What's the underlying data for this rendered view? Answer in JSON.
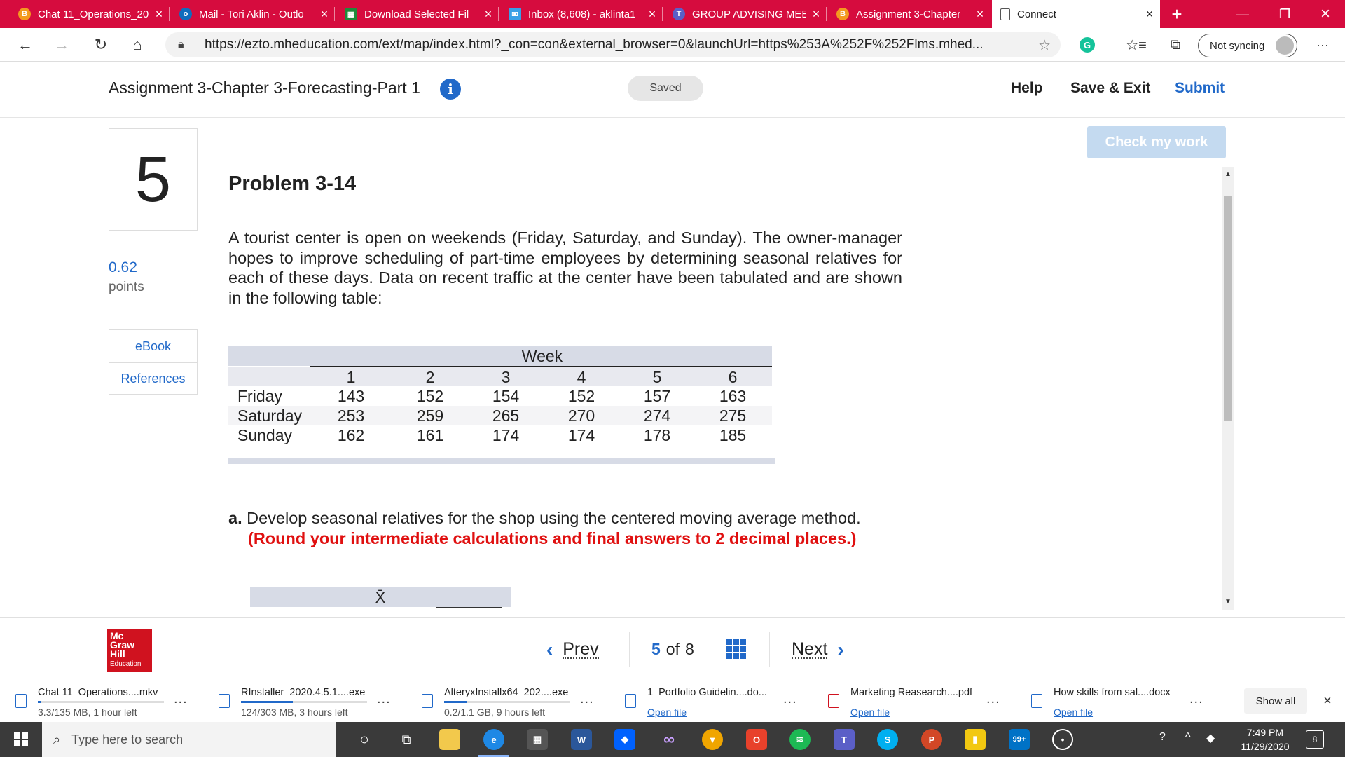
{
  "browser": {
    "tabs": [
      {
        "title": "Chat 11_Operations_20",
        "icon": "b-icon",
        "color": "#f39a1f"
      },
      {
        "title": "Mail - Tori Aklin - Outlo",
        "icon": "outlook-icon",
        "color": "#0f6cbd"
      },
      {
        "title": "Download Selected Fil",
        "icon": "spreadsheet-icon",
        "color": "#1f8a3b"
      },
      {
        "title": "Inbox (8,608) - aklinta1",
        "icon": "inbox-icon",
        "color": "#3aa0e6"
      },
      {
        "title": "GROUP ADVISING MEE",
        "icon": "teams-icon",
        "color": "#5b5fc7"
      },
      {
        "title": "Assignment 3-Chapter",
        "icon": "b-icon",
        "color": "#f39a1f"
      },
      {
        "title": "Connect",
        "icon": "page-icon",
        "color": "#ffffff"
      }
    ],
    "close_glyph": "×",
    "new_tab_glyph": "+",
    "url": "https://ezto.mheducation.com/ext/map/index.html?_con=con&external_browser=0&launchUrl=https%253A%252F%252Flms.mhed...",
    "sync_label": "Not syncing"
  },
  "header": {
    "assignment_title": "Assignment 3-Chapter 3-Forecasting-Part 1",
    "info_glyph": "i",
    "saved_label": "Saved",
    "help_label": "Help",
    "save_exit_label": "Save & Exit",
    "submit_label": "Submit"
  },
  "left": {
    "question_number": "5",
    "points_value": "0.62",
    "points_label": "points",
    "resources": [
      "eBook",
      "References"
    ]
  },
  "check_label": "Check my work",
  "problem": {
    "title": "Problem 3-14",
    "text": "A tourist center is open on weekends (Friday, Saturday, and Sunday). The owner-manager hopes to improve scheduling of part-time employees by determining seasonal relatives for each of these days. Data on recent traffic at the center have been tabulated and are shown in the following table:",
    "table": {
      "group_header": "Week",
      "weeks": [
        "1",
        "2",
        "3",
        "4",
        "5",
        "6"
      ],
      "rows": [
        {
          "label": "Friday",
          "values": [
            "143",
            "152",
            "154",
            "152",
            "157",
            "163"
          ]
        },
        {
          "label": "Saturday",
          "values": [
            "253",
            "259",
            "265",
            "270",
            "274",
            "275"
          ]
        },
        {
          "label": "Sunday",
          "values": [
            "162",
            "161",
            "174",
            "174",
            "178",
            "185"
          ]
        }
      ]
    },
    "part_a_prefix": "a.",
    "part_a_text": "Develop seasonal relatives for the shop using the centered moving average method.",
    "part_a_note": "(Round your intermediate calculations and final answers to 2 decimal places.)",
    "xbar_label": "X̄"
  },
  "footer": {
    "logo_lines": [
      "Mc",
      "Graw",
      "Hill"
    ],
    "logo_sub": "Education",
    "prev_label": "Prev",
    "current_page": "5",
    "of_label": "of",
    "total_pages": "8",
    "next_label": "Next"
  },
  "downloads": [
    {
      "name": "Chat 11_Operations....mkv",
      "status": "3.3/135 MB, 1 hour left",
      "progress": 0.03,
      "link": false
    },
    {
      "name": "RInstaller_2020.4.5.1....exe",
      "status": "124/303 MB, 3 hours left",
      "progress": 0.41,
      "link": false
    },
    {
      "name": "AlteryxInstallx64_202....exe",
      "status": "0.2/1.1 GB, 9 hours left",
      "progress": 0.18,
      "link": false
    },
    {
      "name": "1_Portfolio Guidelin....do...",
      "status": "Open file",
      "progress": null,
      "link": true
    },
    {
      "name": "Marketing Reasearch....pdf",
      "status": "Open file",
      "progress": null,
      "link": true
    },
    {
      "name": "How skills from sal....docx",
      "status": "Open file",
      "progress": null,
      "link": true
    }
  ],
  "downloads_more_glyph": "...",
  "show_all_label": "Show all",
  "taskbar": {
    "search_placeholder": "Type here to search",
    "time": "7:49 PM",
    "date": "11/29/2020",
    "notifications": "8",
    "badge": "99+"
  }
}
